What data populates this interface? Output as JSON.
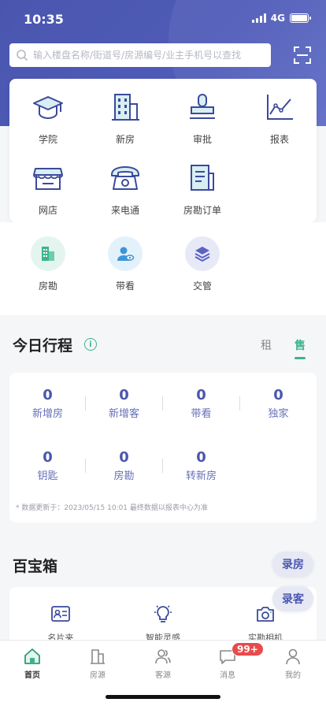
{
  "status": {
    "time": "10:35",
    "network": "4G"
  },
  "search": {
    "placeholder": "输入楼盘名称/街道号/房源编号/业主手机号以查找"
  },
  "grid": [
    {
      "label": "学院",
      "icon": "graduation-cap-icon"
    },
    {
      "label": "新房",
      "icon": "building-icon"
    },
    {
      "label": "审批",
      "icon": "stamp-icon"
    },
    {
      "label": "报表",
      "icon": "line-chart-icon"
    },
    {
      "label": "网店",
      "icon": "shop-icon"
    },
    {
      "label": "来电通",
      "icon": "telephone-icon"
    },
    {
      "label": "房勘订单",
      "icon": "document-icon"
    }
  ],
  "circles": [
    {
      "label": "房勘",
      "icon": "building-survey-icon",
      "bg": "#e3f5ee",
      "color": "#3cb48a"
    },
    {
      "label": "带看",
      "icon": "user-view-icon",
      "bg": "#e3f1fb",
      "color": "#3c95d8"
    },
    {
      "label": "交管",
      "icon": "layers-icon",
      "bg": "#e8e9f7",
      "color": "#5a62c2"
    }
  ],
  "schedule": {
    "title": "今日行程",
    "tabs": [
      {
        "label": "租"
      },
      {
        "label": "售"
      }
    ],
    "active_tab": "售",
    "stats": [
      {
        "value": "0",
        "label": "新增房"
      },
      {
        "value": "0",
        "label": "新增客"
      },
      {
        "value": "0",
        "label": "带看"
      },
      {
        "value": "0",
        "label": "独家"
      },
      {
        "value": "0",
        "label": "钥匙"
      },
      {
        "value": "0",
        "label": "房勘"
      },
      {
        "value": "0",
        "label": "转新房"
      }
    ],
    "note": "* 数据更新于：2023/05/15 10:01 最终数据以报表中心为准"
  },
  "toolbox": {
    "title": "百宝箱",
    "tools": [
      {
        "label": "名片夹",
        "icon": "id-card-icon"
      },
      {
        "label": "智能灵感",
        "icon": "lightbulb-icon"
      },
      {
        "label": "实勘相机",
        "icon": "camera-icon"
      }
    ]
  },
  "floating": {
    "add_house": "录房",
    "add_client": "录客"
  },
  "tabbar": {
    "items": [
      {
        "label": "首页",
        "icon": "home-icon"
      },
      {
        "label": "房源",
        "icon": "house-listing-icon"
      },
      {
        "label": "客源",
        "icon": "clients-icon"
      },
      {
        "label": "消息",
        "icon": "message-icon"
      },
      {
        "label": "我的",
        "icon": "profile-icon"
      }
    ],
    "message_badge": "99+"
  },
  "colors": {
    "brand": "#4a56ae",
    "accent": "#3cb48a",
    "badge": "#e94b4b"
  }
}
